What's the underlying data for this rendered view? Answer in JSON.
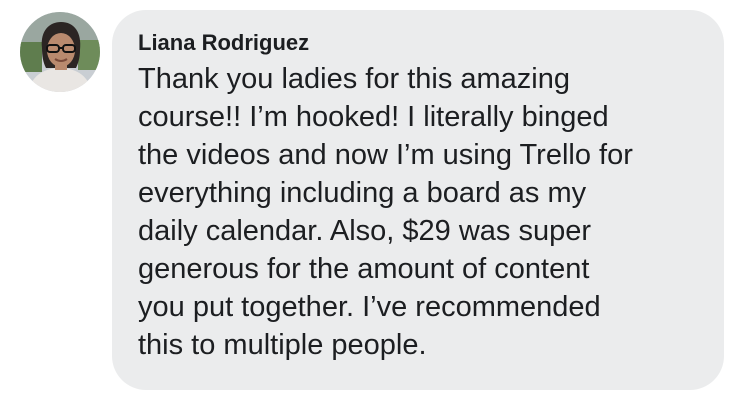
{
  "comment": {
    "author": "Liana Rodriguez",
    "avatar_icon": "profile-photo-avatar",
    "lines": [
      "Thank you ladies for this amazing",
      "course!! I’m hooked! I literally binged",
      "the videos and now I’m using Trello for",
      "everything including a board as my",
      "daily calendar. Also, $29 was super",
      "generous for the amount of content",
      "you put together. I’ve recommended",
      "this to multiple people."
    ]
  },
  "colors": {
    "bubble_background": "#ebeced",
    "text": "#1c1e21"
  }
}
